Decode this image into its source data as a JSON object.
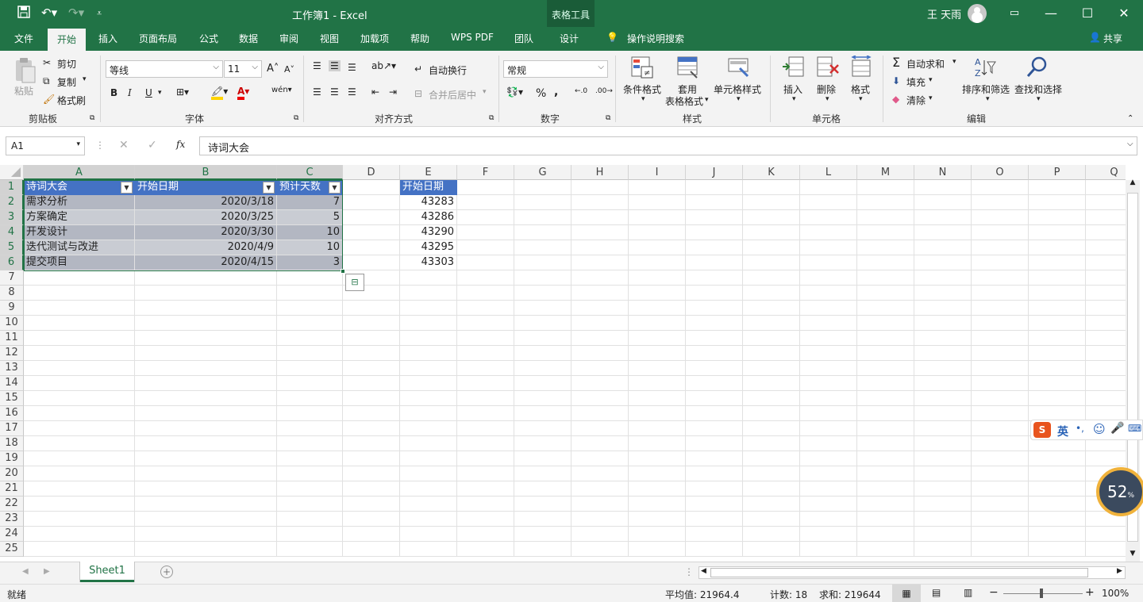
{
  "title_bar": {
    "document_title": "工作簿1  -  Excel",
    "context_tab_group": "表格工具",
    "user_name": "王 天雨",
    "window_buttons": [
      "ribbon-display-options",
      "minimize",
      "maximize",
      "close"
    ]
  },
  "ribbon_tabs": [
    "文件",
    "开始",
    "插入",
    "页面布局",
    "公式",
    "数据",
    "审阅",
    "视图",
    "加载项",
    "帮助",
    "WPS PDF",
    "团队",
    "设计"
  ],
  "active_tab": "开始",
  "tell_me": "操作说明搜索",
  "share": "共享",
  "ribbon": {
    "clipboard": {
      "label": "剪贴板",
      "paste": "粘贴",
      "cut": "剪切",
      "copy": "复制",
      "format_painter": "格式刷"
    },
    "font": {
      "label": "字体",
      "font_name": "等线",
      "font_size": "11",
      "bold": "B",
      "italic": "I",
      "underline": "U",
      "phonetic": "wén"
    },
    "alignment": {
      "label": "对齐方式",
      "wrap_text": "自动换行",
      "merge_center": "合并后居中"
    },
    "number": {
      "label": "数字",
      "format": "常规",
      "percent": "%",
      "comma": ","
    },
    "styles": {
      "label": "样式",
      "conditional_format": "条件格式",
      "table_format_line1": "套用",
      "table_format_line2": "表格格式",
      "cell_styles": "单元格样式"
    },
    "cells": {
      "label": "单元格",
      "insert": "插入",
      "delete": "删除",
      "format": "格式"
    },
    "editing": {
      "label": "编辑",
      "autosum": "自动求和",
      "fill": "填充",
      "clear": "清除",
      "sort_filter": "排序和筛选",
      "find_select": "查找和选择"
    }
  },
  "formula_bar": {
    "name_box": "A1",
    "fx": "fx",
    "content": "诗词大会"
  },
  "columns": [
    "A",
    "B",
    "C",
    "D",
    "E",
    "F",
    "G",
    "H",
    "I",
    "J",
    "K",
    "L",
    "M",
    "N",
    "O",
    "P",
    "Q"
  ],
  "rows": [
    "1",
    "2",
    "3",
    "4",
    "5",
    "6",
    "7",
    "8",
    "9",
    "10",
    "11",
    "12",
    "13",
    "14",
    "15",
    "16",
    "17",
    "18",
    "19",
    "20",
    "21",
    "22",
    "23",
    "24",
    "25"
  ],
  "table": {
    "headers": [
      "诗词大会",
      "开始日期",
      "预计天数"
    ],
    "rows": [
      [
        "需求分析",
        "2020/3/18",
        "7"
      ],
      [
        "方案确定",
        "2020/3/25",
        "5"
      ],
      [
        "开发设计",
        "2020/3/30",
        "10"
      ],
      [
        "迭代测试与改进",
        "2020/4/9",
        "10"
      ],
      [
        "提交项目",
        "2020/4/15",
        "3"
      ]
    ]
  },
  "column_e": {
    "header": "开始日期",
    "values": [
      "43283",
      "43286",
      "43290",
      "43295",
      "43303"
    ]
  },
  "sheet_tabs": [
    "Sheet1"
  ],
  "status_bar": {
    "mode": "就绪",
    "average": "平均值: 21964.4",
    "count": "计数: 18",
    "sum": "求和: 219644",
    "zoom": "100%"
  },
  "ime_toolbar": {
    "logo": "S",
    "lang": "英"
  },
  "overlay_gauge": {
    "value": "52",
    "unit": "%"
  },
  "colors": {
    "excel_green": "#217346",
    "table_header": "#4472c4",
    "band_dark": "#b3b7c2",
    "band_light": "#c9ccd3"
  }
}
